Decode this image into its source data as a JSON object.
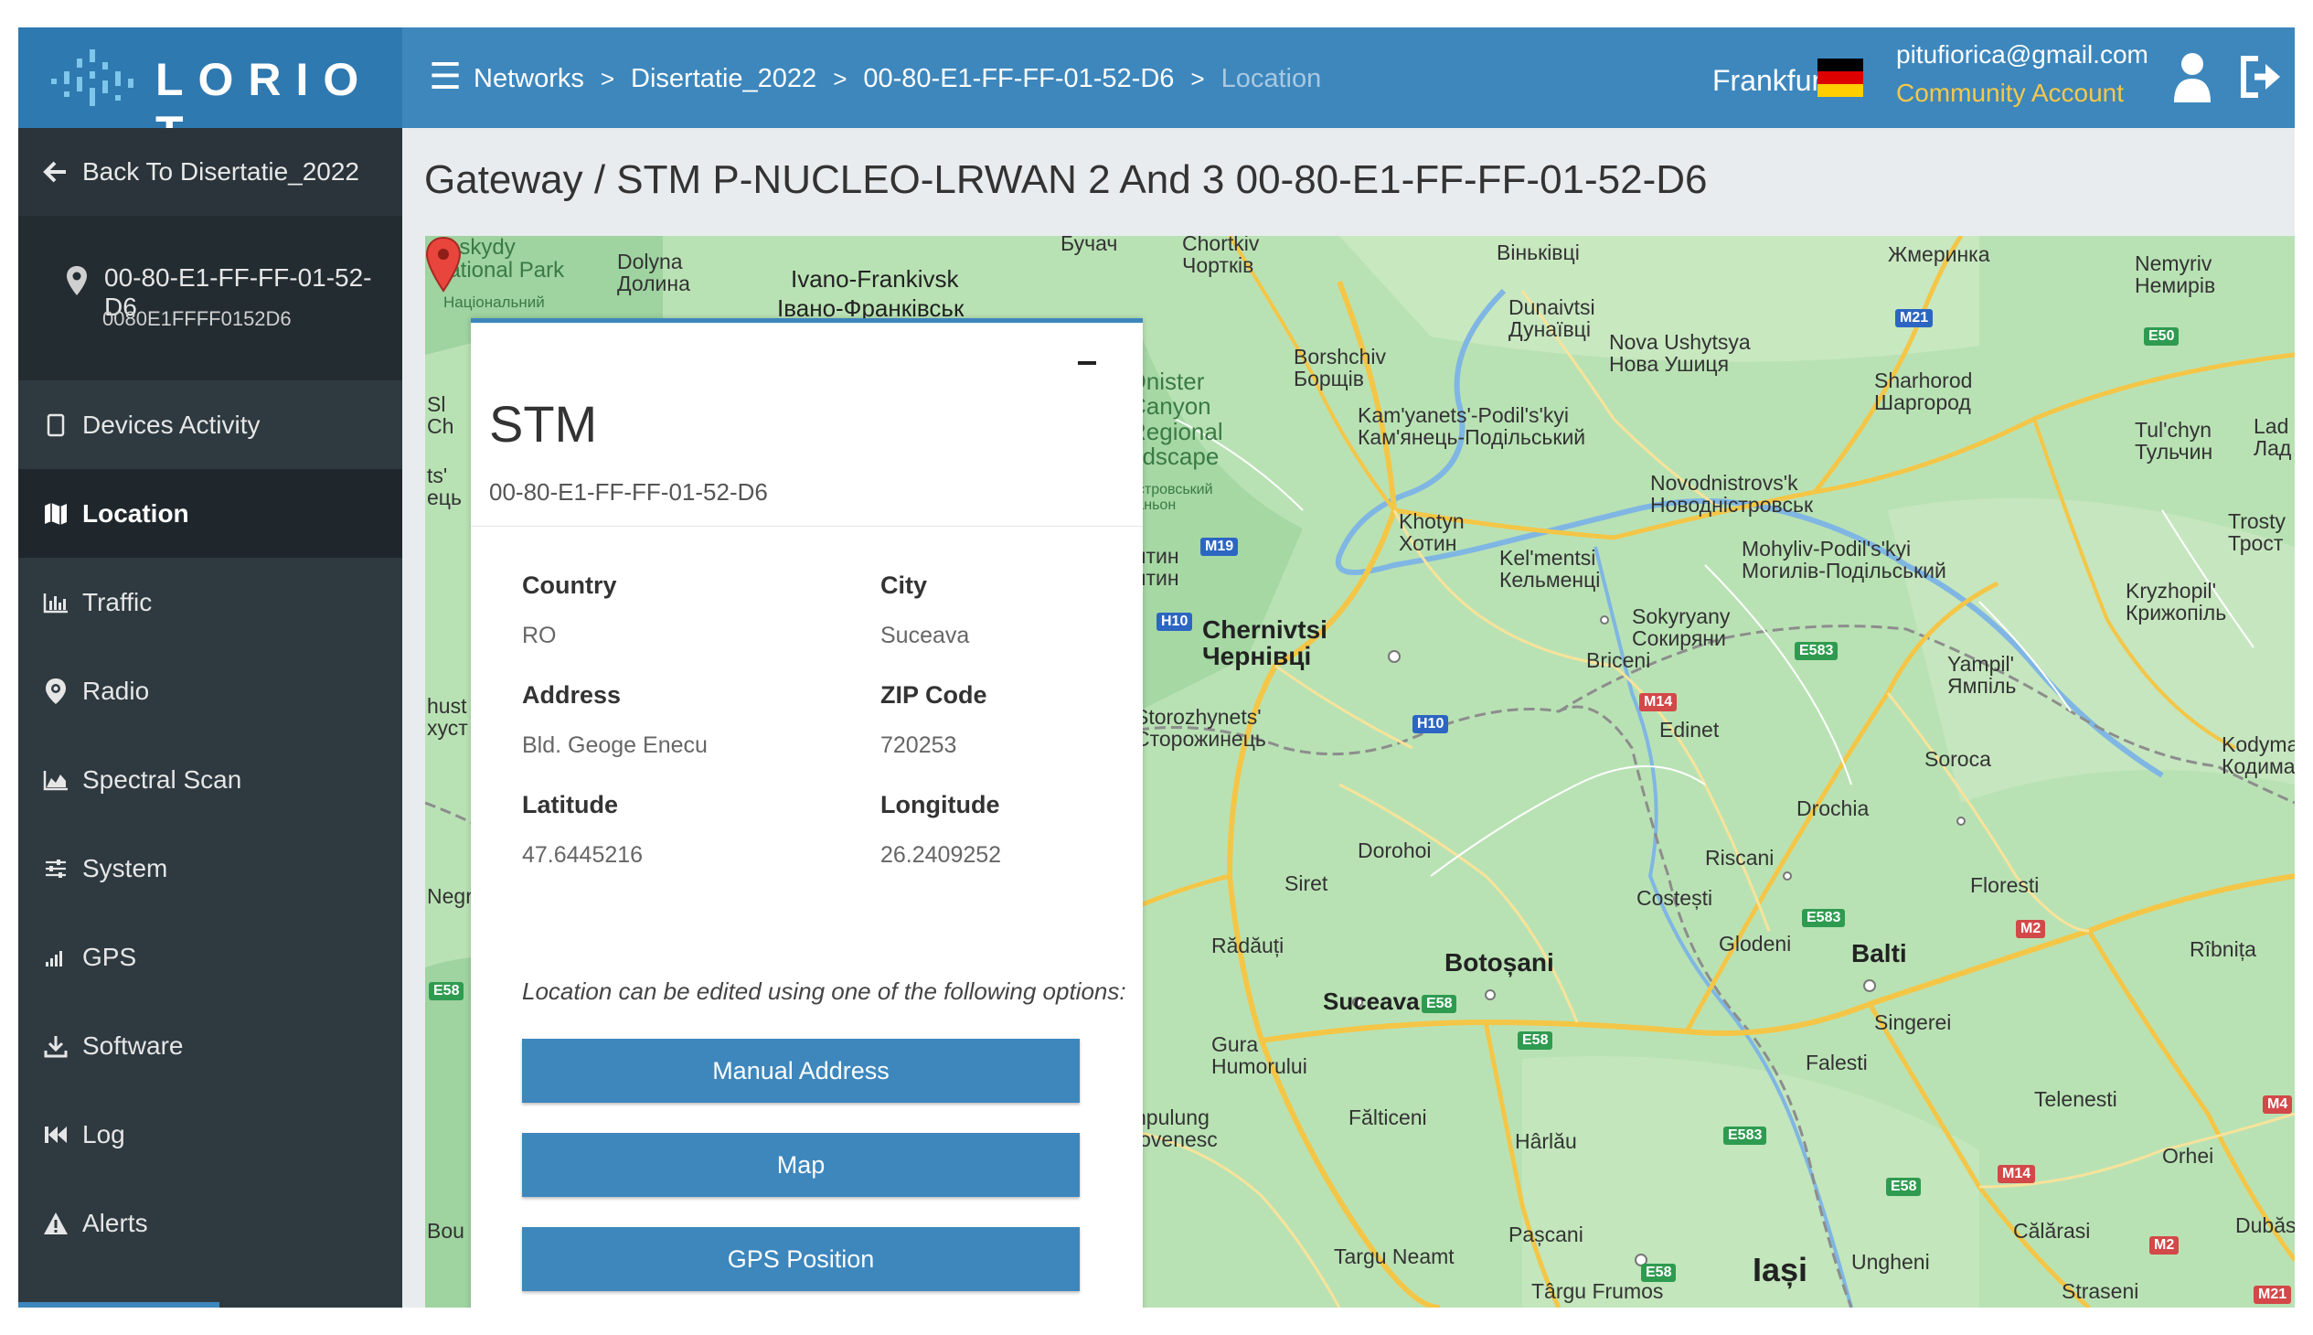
{
  "brand": {
    "name": "LORIO T"
  },
  "breadcrumb": {
    "items": [
      "Networks",
      "Disertatie_2022",
      "00-80-E1-FF-FF-01-52-D6"
    ],
    "current": "Location",
    "separator": ">"
  },
  "header": {
    "region": "Frankfurt",
    "email": "pitufiorica@gmail.com",
    "account_type": "Community Account"
  },
  "sidebar": {
    "back_label": "Back To Disertatie_2022",
    "gateway_id": "00-80-E1-FF-FF-01-52-D6",
    "gateway_eui": "0080E1FFFF0152D6",
    "items": [
      {
        "label": "Devices Activity",
        "icon": "device-icon"
      },
      {
        "label": "Location",
        "icon": "map-icon",
        "active": true
      },
      {
        "label": "Traffic",
        "icon": "bar-chart-icon"
      },
      {
        "label": "Radio",
        "icon": "radio-pin-icon"
      },
      {
        "label": "Spectral Scan",
        "icon": "area-chart-icon"
      },
      {
        "label": "System",
        "icon": "sliders-icon"
      },
      {
        "label": "GPS",
        "icon": "signal-icon"
      },
      {
        "label": "Software",
        "icon": "download-icon"
      },
      {
        "label": "Log",
        "icon": "rewind-icon"
      },
      {
        "label": "Alerts",
        "icon": "warning-icon"
      }
    ]
  },
  "page": {
    "title": "Gateway / STM P-NUCLEO-LRWAN 2 And 3 00-80-E1-FF-FF-01-52-D6"
  },
  "panel": {
    "title": "STM",
    "subtitle": "00-80-E1-FF-FF-01-52-D6",
    "fields": {
      "country": {
        "label": "Country",
        "value": "RO"
      },
      "city": {
        "label": "City",
        "value": "Suceava"
      },
      "address": {
        "label": "Address",
        "value": "Bld. Geoge Enecu"
      },
      "zip": {
        "label": "ZIP Code",
        "value": "720253"
      },
      "latitude": {
        "label": "Latitude",
        "value": "47.6445216"
      },
      "longitude": {
        "label": "Longitude",
        "value": "26.2409252"
      }
    },
    "note": "Location can be edited using one of the following options:",
    "buttons": {
      "manual": "Manual Address",
      "map": "Map",
      "gps": "GPS Position"
    }
  },
  "map": {
    "labels": {
      "beskydy": "Beskydy\nNational Park",
      "beskydy_ua": "Національний",
      "dolyna": "Dolyna\nДолина",
      "ivano": "Ivano-Frankivsk",
      "ivano_ua": "Івано-Франківськ",
      "buchach": "Бучач",
      "chortkiv": "Chortkiv\nЧортків",
      "vinkivtsi": "Віньківці",
      "zhmerynka": "Жмеринка",
      "nemyriv": "Nemyriv\nНемирів",
      "dunaivtsi": "Dunaivtsi\nДунаївці",
      "nova_ushytsia": "Nova Ushytsya\nНова Ушиця",
      "sharhorod": "Sharhorod\nШаргород",
      "borshchiv": "Borshchiv\nБорщів",
      "dnister": "Dnister\nCanyon\nRegional\nndscape",
      "dnister_ua": "естровський\nканьон",
      "kamyanets": "Kam'yanets'-Podil's'kyi\nКам'янець-Подільський",
      "tulchyn": "Tul'chyn\nТульчин",
      "lad": "Lad\nЛад",
      "novodnistrovsk": "Novodnistrovs'k\nНоводністровськ",
      "trosty": "Trosty\nТрост",
      "khotyn": "Khotyn\nХотин",
      "kelmentsi": "Kel'mentsi\nКельменці",
      "mohyliv": "Mohyliv-Podil's'kyi\nМогилів-Подільський",
      "kryzhopil": "Kryzhopil'\nКрижопіль",
      "vyatyn": "ятин\nятин",
      "sokyryany": "Sokyryany\nСокиряни",
      "chernivtsi": "Chernivtsi\nЧернівці",
      "briceni": "Briceni",
      "yampil": "Yampil'\nЯмпіль",
      "edinet": "Edinet",
      "storozhynets": "Storozhynets'\nСторожинець",
      "soroca": "Soroca",
      "kodyma": "Kodyma\nКодима",
      "drochia": "Drochia",
      "dorohoi": "Dorohoi",
      "riscani": "Riscani",
      "siret": "Siret",
      "floresti": "Floresti",
      "costesti": "Costești",
      "radauti": "Rădăuți",
      "glodeni": "Glodeni",
      "botosani": "Botoșani",
      "balti": "Balti",
      "ribnita": "Rîbnița",
      "suceava": "Suceava",
      "gura": "Gura\nHumorului",
      "singerei": "Singerei",
      "falesti": "Falesti",
      "npulung": "npulung\nlovenesc",
      "falticeni": "Fălticeni",
      "telenesti": "Telenesti",
      "harlau": "Hârlău",
      "orhei": "Orhei",
      "pascani": "Pașcani",
      "calarasi": "Călărasi",
      "dubasa": "Dubăsa",
      "targu_neamt": "Targu Neamt",
      "iasi": "Iași",
      "ungheni": "Ungheni",
      "targu_frumos": "Târgu Frumos",
      "straseni": "Straseni",
      "left_sl": "Sl\nCh",
      "left_ts": "ts'\nець",
      "left_chust": "hust\nхуст",
      "left_negr": "Negr",
      "left_bou": "Bou"
    },
    "roads": {
      "m21": "M21",
      "e50a": "E50",
      "m19": "M19",
      "h10a": "H10",
      "h10b": "H10",
      "m14a": "M14",
      "e583a": "E583",
      "e583b": "E583",
      "e583c": "E583",
      "m2a": "M2",
      "e58a": "E58",
      "e58b": "E58",
      "e58c": "E58",
      "e58d": "E58",
      "e58e": "E58",
      "m14b": "M14",
      "m4": "M4",
      "m2b": "M2",
      "m21b": "M21"
    }
  },
  "colors": {
    "accent": "#3d87bd",
    "sidebar": "#2e3940",
    "account_type": "#f6c84a",
    "map_land": "#b9e2b4",
    "marker": "#e8453c"
  }
}
